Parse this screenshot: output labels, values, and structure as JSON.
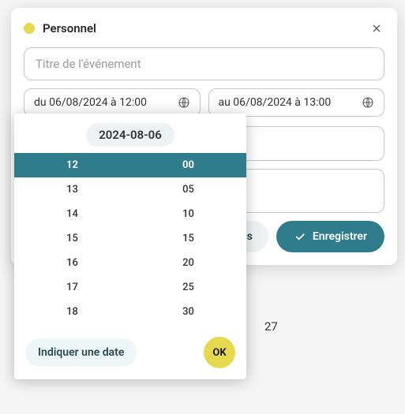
{
  "modal": {
    "title": "Personnel",
    "dot_color": "#e6d94f",
    "event_title_placeholder": "Titre de l'événement",
    "from_field": "du 06/08/2024 à 12:00",
    "to_field": "au 06/08/2024 à 13:00",
    "more_details_label": "Plus de détails",
    "save_label": "Enregistrer"
  },
  "picker": {
    "date_label": "2024-08-06",
    "hours": [
      "12",
      "13",
      "14",
      "15",
      "16",
      "17",
      "18"
    ],
    "minutes": [
      "00",
      "05",
      "10",
      "15",
      "20",
      "25",
      "30"
    ],
    "selected_hour_index": 0,
    "selected_minute_index": 0,
    "indicate_date_label": "Indiquer une date",
    "ok_label": "OK"
  },
  "background": {
    "day_number": "27"
  },
  "icons": {
    "close": "close-icon",
    "globe": "globe-icon",
    "check": "check-icon"
  }
}
